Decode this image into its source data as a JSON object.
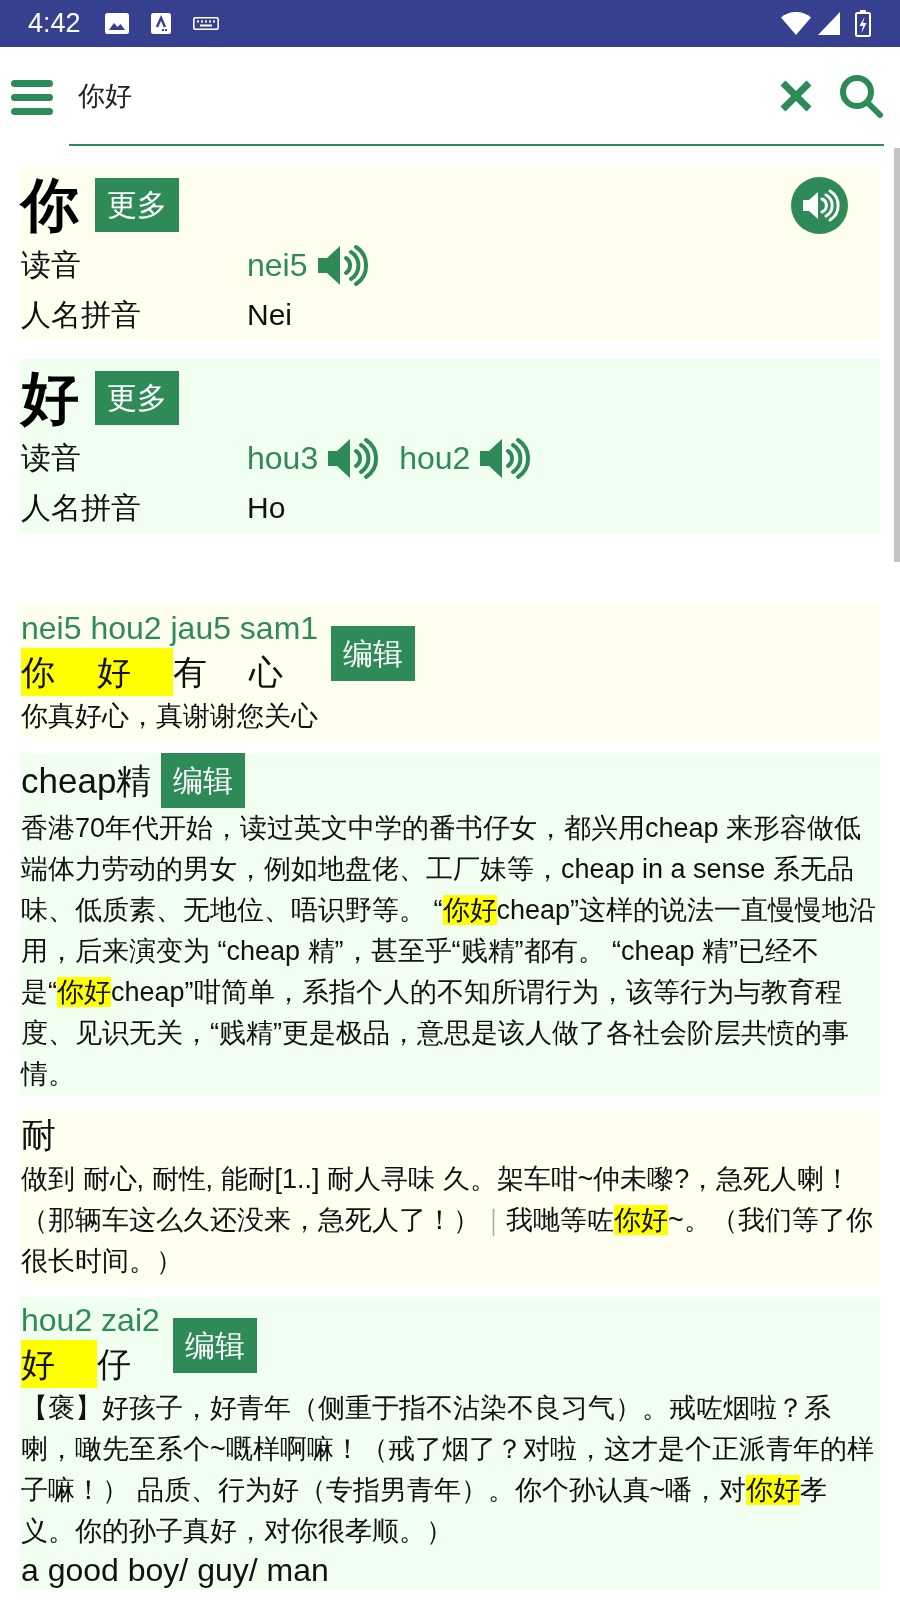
{
  "status_bar": {
    "time": "4:42"
  },
  "search": {
    "value": "你好"
  },
  "characters": [
    {
      "headword": "你",
      "more_button": "更多",
      "audio": true,
      "rows": [
        {
          "kind": "readings",
          "label": "读音",
          "readings": [
            "nei5"
          ]
        },
        {
          "kind": "text",
          "label": "人名拼音",
          "value": "Nei"
        }
      ]
    },
    {
      "headword": "好",
      "more_button": "更多",
      "audio": false,
      "rows": [
        {
          "kind": "readings",
          "label": "读音",
          "readings": [
            "hou3",
            "hou2"
          ]
        },
        {
          "kind": "text",
          "label": "人名拼音",
          "value": "Ho"
        }
      ]
    }
  ],
  "entries": [
    {
      "kind": "phrase",
      "pinyin": "nei5 hou2 jau5 sam1",
      "characters": [
        {
          "char": "你",
          "highlighted": true
        },
        {
          "char": "好",
          "highlighted": true
        },
        {
          "char": "有",
          "highlighted": false
        },
        {
          "char": "心",
          "highlighted": false
        }
      ],
      "edit_button": "编辑",
      "definition": [
        {
          "kind": "plain",
          "text": "你真好心，真谢谢您关心"
        }
      ]
    },
    {
      "kind": "term",
      "title": "cheap精",
      "edit_button": "编辑",
      "definition": [
        {
          "kind": "plain",
          "text": "香港70年代开始，读过英文中学的番书仔女，都兴用cheap 来形容做低端体力劳动的男女，例如地盘佬、工厂妹等，cheap in a sense 系无品味、低质素、无地位、唔识野等。 “"
        },
        {
          "kind": "highlight",
          "text": "你好"
        },
        {
          "kind": "plain",
          "text": "cheap”这样的说法一直慢慢地沿用，后来演变为 “cheap 精”，甚至乎“贱精”都有。 “cheap 精”已经不是“"
        },
        {
          "kind": "highlight",
          "text": "你好"
        },
        {
          "kind": "plain",
          "text": "cheap”咁简单，系指个人的不知所谓行为，该等行为与教育程度、见识无关，“贱精”更是极品，意思是该人做了各社会阶层共愤的事情。"
        }
      ]
    },
    {
      "kind": "term",
      "title": "耐",
      "definition": [
        {
          "kind": "plain",
          "text": "做到 耐心, 耐性, 能耐[1..] 耐人寻味 久。架车咁~仲未嚟?，急死人喇！（那辆车这么久还没来，急死人了！）"
        },
        {
          "kind": "separator",
          "text": "｜"
        },
        {
          "kind": "plain",
          "text": "我哋等咗"
        },
        {
          "kind": "highlight",
          "text": "你好"
        },
        {
          "kind": "plain",
          "text": "~。（我们等了你很长时间。）"
        }
      ]
    },
    {
      "kind": "phrase",
      "pinyin": "hou2 zai2",
      "characters": [
        {
          "char": "好",
          "highlighted": true
        },
        {
          "char": "仔",
          "highlighted": false
        }
      ],
      "edit_button": "编辑",
      "definition": [
        {
          "kind": "plain",
          "text": "【褒】好孩子，好青年（侧重于指不沾染不良习气）。戒咗烟啦？系喇，噉先至系个~嘅样啊嘛！（戒了烟了？对啦，这才是个正派青年的样子嘛！） 品质、行为好（专指男青年）。你个孙认真~噃，对"
        },
        {
          "kind": "highlight",
          "text": "你好"
        },
        {
          "kind": "plain",
          "text": "孝义。你的孙子真好，对你很孝顺。）"
        }
      ],
      "english": "a good boy/ guy/ man"
    }
  ]
}
